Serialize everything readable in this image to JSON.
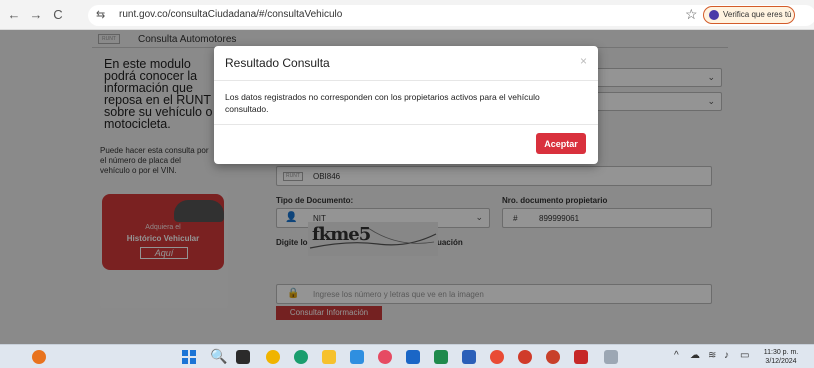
{
  "browser": {
    "url": "runt.gov.co/consultaCiudadana/#/consultaVehiculo",
    "verify_label": "Verifica que eres tú",
    "back_glyph": "←",
    "forward_glyph": "→",
    "reload_glyph": "C",
    "site_glyph": "⇆",
    "star_glyph": "☆"
  },
  "page": {
    "header_title": "Consulta Automotores",
    "plate_badge": "RUNT",
    "intro": "En este modulo podrá conocer la información que reposa en el RUNT sobre su vehículo o motocicleta.",
    "side_note": "Puede hacer esta consulta por el número de placa del vehículo o por el VIN.",
    "promo_line1": "Adquiera el",
    "promo_line2": "Histórico Vehicular",
    "promo_button": "Aquí",
    "plate_value": "OBI846",
    "doc_type_label": "Tipo de Documento:",
    "doc_type_value": "NIT",
    "doc_number_label": "Nro. documento propietario",
    "doc_number_hash": "#",
    "doc_number_value": "899999061",
    "captcha_label": "Digite los caracteres presentados a continuación",
    "captcha_text": "fkme5",
    "captcha_placeholder": "Ingrese los número y letras que ve en la imagen",
    "submit_label": "Consultar Información"
  },
  "modal": {
    "title": "Resultado Consulta",
    "close_glyph": "×",
    "message": "Los datos registrados no corresponden con los propietarios activos para el vehículo consultado.",
    "button_label": "Aceptar"
  },
  "taskbar": {
    "search_glyph": "🔍",
    "clock_time": "11:30 p. m.",
    "clock_date": "3/12/2024"
  },
  "colors": {
    "accent_red": "#d9313d",
    "verify_border": "#d35b2a",
    "overlay": "rgba(0,0,0,0.42)"
  }
}
